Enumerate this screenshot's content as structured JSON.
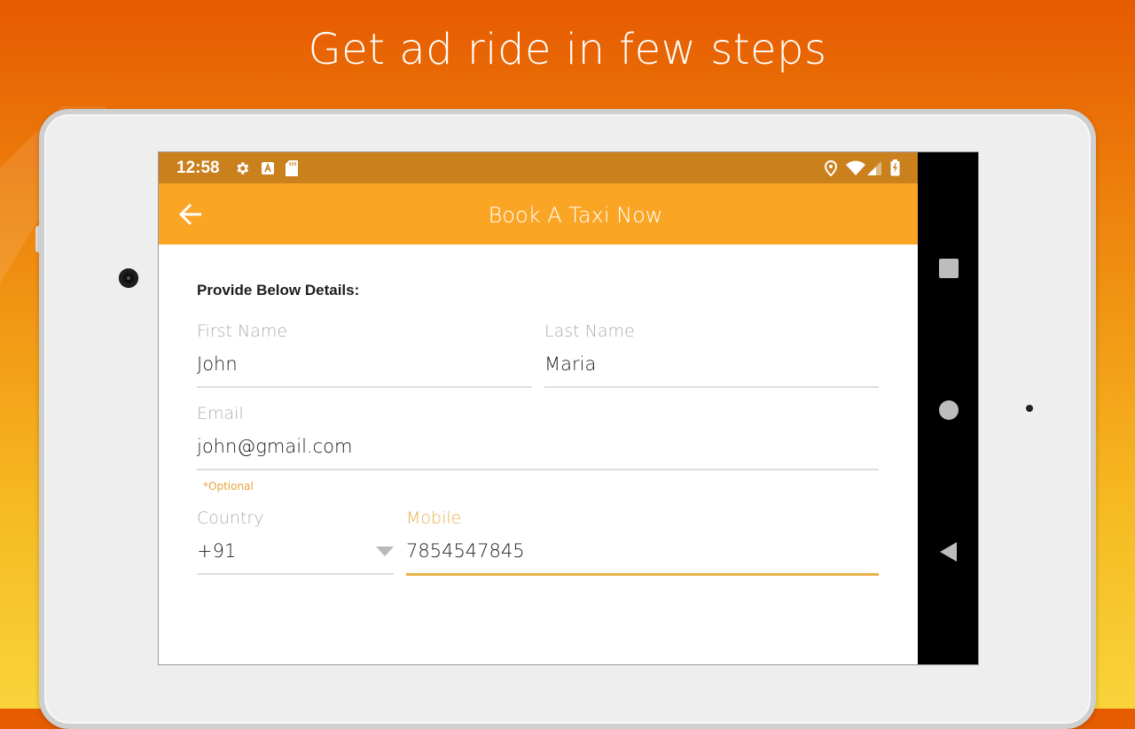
{
  "promo": {
    "headline": "Get ad ride in few steps"
  },
  "statusbar": {
    "time": "12:58",
    "icons": [
      "settings-icon",
      "a-icon",
      "sd-card-icon",
      "location-icon",
      "wifi-icon",
      "signal-icon",
      "battery-charging-icon"
    ]
  },
  "appbar": {
    "title": "Book A Taxi Now",
    "back_icon": "arrow-left-icon"
  },
  "form": {
    "section_title": "Provide Below Details:",
    "first_name": {
      "label": "First Name",
      "value": "John"
    },
    "last_name": {
      "label": "Last Name",
      "value": "Maria"
    },
    "email": {
      "label": "Email",
      "value": "john@gmail.com",
      "helper": "*Optional"
    },
    "country": {
      "label": "Country",
      "value": "+91"
    },
    "mobile": {
      "label": "Mobile",
      "value": "7854547845"
    }
  },
  "navbar": {
    "icons": [
      "recents-square-icon",
      "home-circle-icon",
      "back-triangle-icon"
    ]
  },
  "colors": {
    "statusbar": "#c9801d",
    "appbar": "#fba525",
    "accent": "#e8b14a"
  }
}
